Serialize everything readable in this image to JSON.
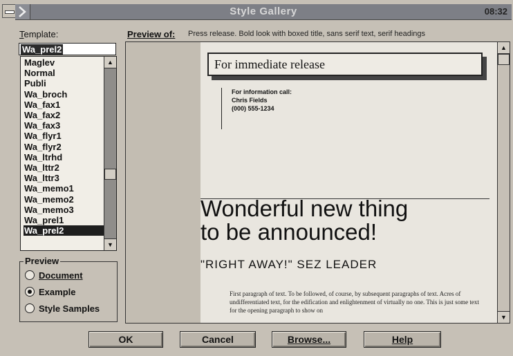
{
  "window": {
    "title": "Style Gallery",
    "title_right": "08:32"
  },
  "template": {
    "label": "Template:",
    "input_value": "Wa_prel2",
    "items": [
      "Maglev",
      "Normal",
      "Publi",
      "Wa_broch",
      "Wa_fax1",
      "Wa_fax2",
      "Wa_fax3",
      "Wa_flyr1",
      "Wa_flyr2",
      "Wa_ltrhd",
      "Wa_lttr2",
      "Wa_lttr3",
      "Wa_memo1",
      "Wa_memo2",
      "Wa_memo3",
      "Wa_prel1",
      "Wa_prel2"
    ],
    "selected": "Wa_prel2"
  },
  "preview_of": {
    "label": "Preview of:",
    "description": "Press release. Bold look with boxed title, sans serif text, serif headings"
  },
  "preview_group": {
    "title": "Preview",
    "options": [
      "Document",
      "Example",
      "Style Samples"
    ],
    "selected": "Example"
  },
  "document": {
    "boxed_title": "For immediate release",
    "info_lines": [
      "For information call:",
      "Chris Fields",
      "(000) 555-1234"
    ],
    "headline_line1": "Wonderful new thing",
    "headline_line2": "to be announced!",
    "subhead": "\"RIGHT AWAY!\" SEZ LEADER",
    "body": "First paragraph of text. To be followed, of course, by subsequent paragraphs of text. Acres of undifferentiated text, for the edification and enlightenment of virtually no one. This is just some text for the opening paragraph to show on"
  },
  "buttons": {
    "ok": "OK",
    "cancel": "Cancel",
    "browse": "Browse...",
    "help": "Help"
  }
}
